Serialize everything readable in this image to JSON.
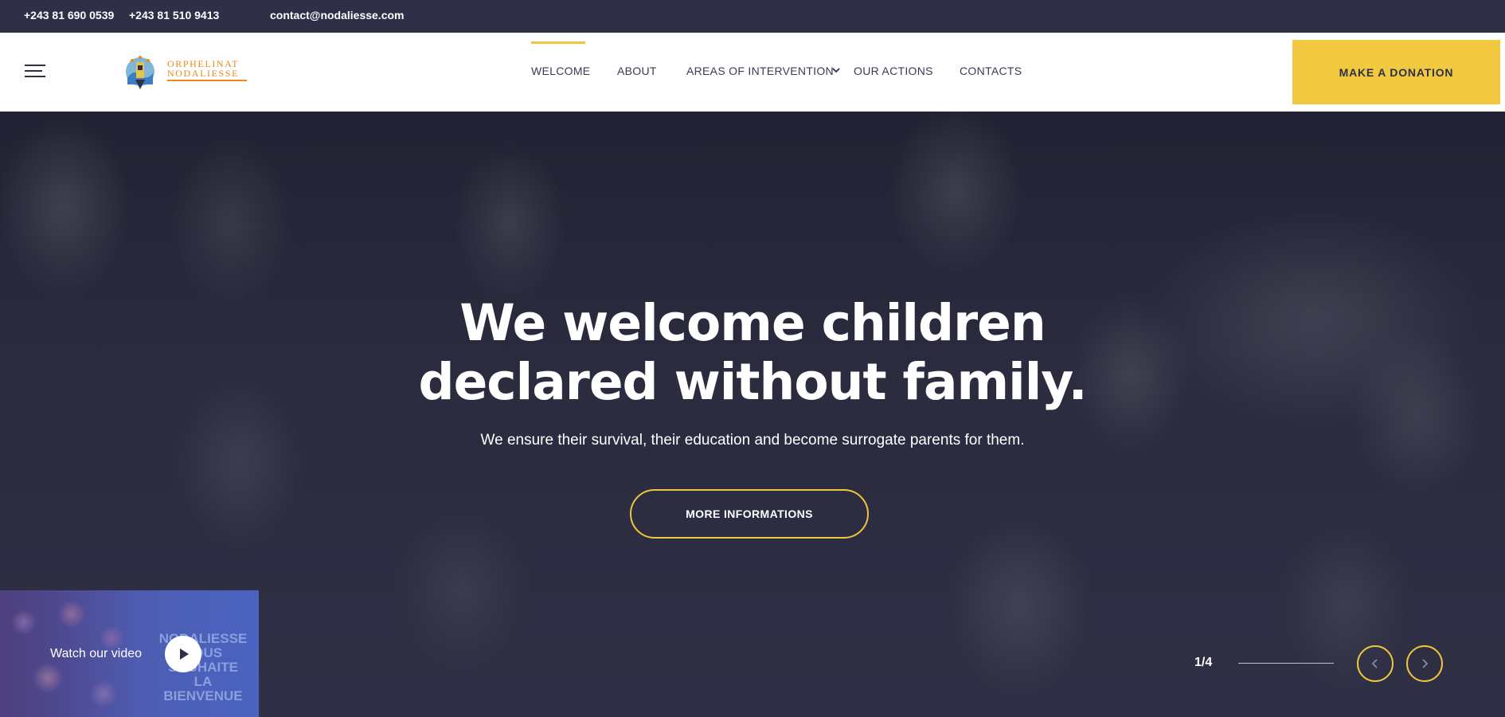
{
  "topbar": {
    "phone1": "+243 81 690 0539",
    "phone2": "+243 81 510 9413",
    "email": "contact@nodaliesse.com"
  },
  "header": {
    "logo": {
      "line1": "ORPHELINAT",
      "line2": "NODALIESSE",
      "icon": "logo-emblem"
    },
    "menu_icon": "hamburger-icon",
    "nav": [
      {
        "label": "WELCOME",
        "active": true
      },
      {
        "label": "ABOUT"
      },
      {
        "label": "AREAS OF INTERVENTION",
        "has_dropdown": true
      },
      {
        "label": "OUR ACTIONS"
      },
      {
        "label": "CONTACTS"
      }
    ],
    "donate_label": "MAKE A DONATION"
  },
  "hero": {
    "title_line1": "We welcome children",
    "title_line2": "declared without family.",
    "subtitle": "We ensure their survival, their education and become surrogate parents for them.",
    "button_label": "MORE INFORMATIONS",
    "video": {
      "label": "Watch our video",
      "bg_text": [
        "NODALIESSE",
        "VOUS",
        "SOUHAITE",
        "LA",
        "BIENVENUE"
      ],
      "icon": "play-icon"
    },
    "slider": {
      "counter": "1/4",
      "prev_icon": "chevron-left-icon",
      "next_icon": "chevron-right-icon"
    }
  },
  "colors": {
    "topbar_bg": "#2f3048",
    "accent": "#f0c940",
    "logo_orange": "#e8891a",
    "hero_overlay": "#28283e"
  }
}
